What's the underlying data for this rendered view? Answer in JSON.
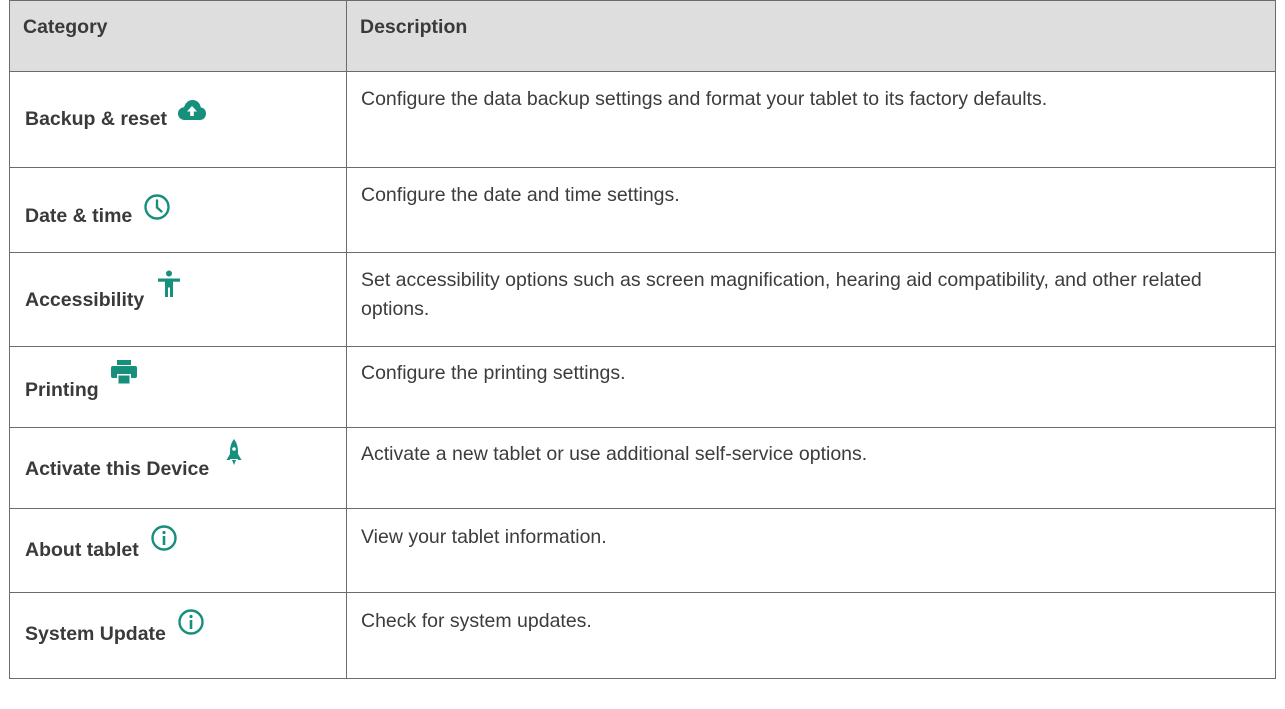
{
  "table": {
    "headers": {
      "category": "Category",
      "description": "Description"
    },
    "accent_color": "#168f7c",
    "rows": [
      {
        "category": "Backup & reset",
        "icon": "cloud-upload-icon",
        "description": "Configure the data backup settings and format your tablet to its factory defaults."
      },
      {
        "category": "Date & time",
        "icon": "clock-icon",
        "description": "Configure the date and time settings."
      },
      {
        "category": "Accessibility",
        "icon": "accessibility-person-icon",
        "description": "Set accessibility options such as screen magnification, hearing aid compatibility, and other related options."
      },
      {
        "category": "Printing",
        "icon": "printer-icon",
        "description": "Configure the printing settings."
      },
      {
        "category": "Activate this Device",
        "icon": "rocket-icon",
        "description": "Activate a new tablet or use additional self-service options."
      },
      {
        "category": "About tablet",
        "icon": "info-icon",
        "description": "View your tablet information."
      },
      {
        "category": "System Update",
        "icon": "info-icon",
        "description": "Check for system updates."
      }
    ]
  }
}
